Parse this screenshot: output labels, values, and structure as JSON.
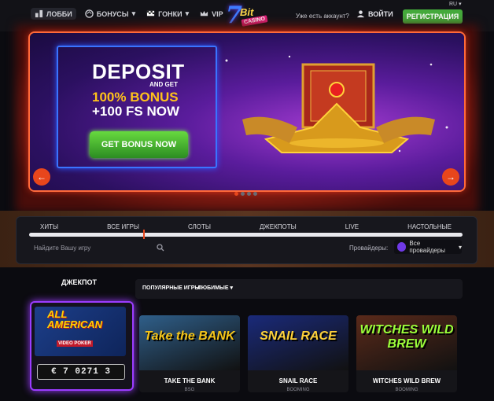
{
  "nav": {
    "items": [
      {
        "label": "ЛОББИ",
        "icon": "lobby-icon"
      },
      {
        "label": "БОНУСЫ",
        "icon": "bonus-icon",
        "dropdown": true
      },
      {
        "label": "ГОНКИ",
        "icon": "flag-icon",
        "dropdown": true
      },
      {
        "label": "VIP",
        "icon": "crown-icon"
      }
    ]
  },
  "logo": {
    "seven": "7",
    "bit": "Bit",
    "casino": "CASINO"
  },
  "header": {
    "account_question": "Уже есть аккаунт?",
    "login_label": "ВОЙТИ",
    "register_label": "РЕГИСТРАЦИЯ",
    "language": "RU"
  },
  "banner": {
    "line1": "DEPOSIT",
    "line2": "AND GET",
    "line3": "100% BONUS",
    "line4": "+100 FS NOW",
    "cta": "GET BONUS NOW",
    "prev_arrow": "←",
    "next_arrow": "→",
    "slides": 4,
    "active_slide": 1
  },
  "filters": {
    "categories": [
      "ХИТЫ",
      "ВСЕ ИГРЫ",
      "СЛОТЫ",
      "ДЖЕКПОТЫ",
      "LIVE",
      "НАСТОЛЬНЫЕ"
    ],
    "active_category": "ВСЕ ИГРЫ",
    "search_placeholder": "Найдите Вашу игру",
    "providers_label": "Провайдеры:",
    "providers_value": "Все провайдеры"
  },
  "jackpot": {
    "title": "ДЖЕКПОТ",
    "game_line1": "ALL",
    "game_line2": "AMERICAN",
    "game_line3": "VIDEO POKER",
    "counter": "€ 7 0271 3"
  },
  "games_tabs": {
    "popular": "ПОПУЛЯРНЫЕ ИГРЫ",
    "favorites": "ЛЮБИМЫЕ"
  },
  "games": [
    {
      "title": "TAKE THE BANK",
      "provider": "BSG",
      "art": "Take the BANK",
      "color": "#f5c518",
      "bg": "#2f5f8a"
    },
    {
      "title": "SNAIL RACE",
      "provider": "BOOMING",
      "art": "SNAIL RACE",
      "color": "#ffd23a",
      "bg": "#1a2a7a"
    },
    {
      "title": "WITCHES WILD BREW",
      "provider": "BOOMING",
      "art": "WITCHES WILD BREW",
      "color": "#9bff3a",
      "bg": "#5a2a1a"
    }
  ],
  "colors": {
    "accent": "#e8461c",
    "register": "#44a93b",
    "jackpot_border": "#9b3cff"
  }
}
